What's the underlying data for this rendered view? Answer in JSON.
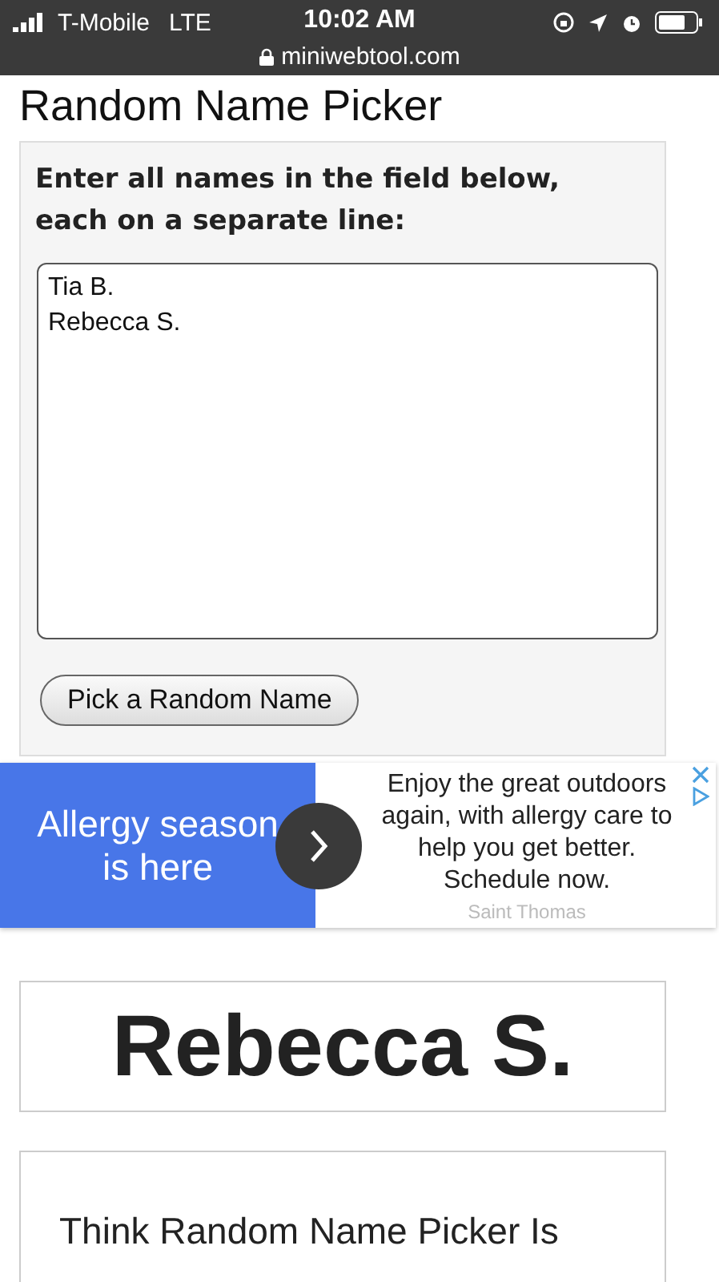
{
  "status_bar": {
    "carrier": "T-Mobile",
    "network": "LTE",
    "time": "10:02 AM",
    "url": "miniwebtool.com"
  },
  "title": "Random Name Picker",
  "form": {
    "label": "Enter all names in the field below, each on a separate line:",
    "names_value": "Tia B.\nRebecca S.",
    "button": "Pick a Random Name"
  },
  "ad": {
    "headline": "Allergy season is here",
    "body": "Enjoy the great outdoors again, with allergy care to help you get better. Schedule now.",
    "advertiser": "Saint Thomas"
  },
  "result": "Rebecca S.",
  "promo": {
    "text": "Think Random Name Picker Is"
  }
}
